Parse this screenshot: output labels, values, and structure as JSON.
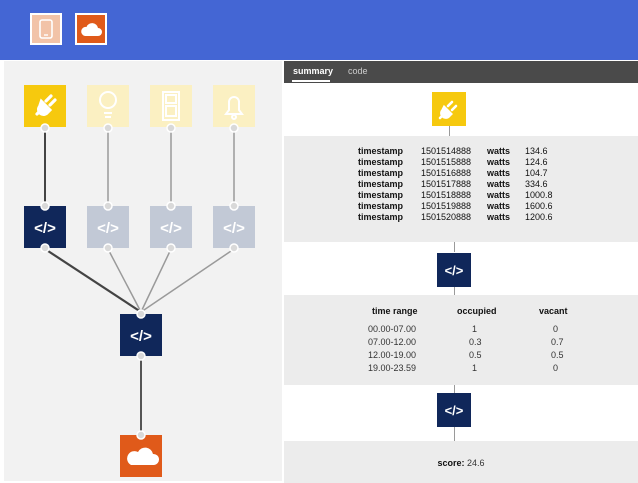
{
  "toolbar": {
    "buttons": [
      {
        "icon": "phone-icon",
        "color": "#f2c3a8"
      },
      {
        "icon": "cloud-icon",
        "color": "#e05a1a"
      }
    ]
  },
  "graph": {
    "sensors": [
      {
        "icon": "plug-icon",
        "active": true
      },
      {
        "icon": "lightbulb-icon",
        "active": false
      },
      {
        "icon": "door-icon",
        "active": false
      },
      {
        "icon": "bell-icon",
        "active": false
      }
    ],
    "code_nodes": [
      {
        "icon": "code-icon",
        "active": true
      },
      {
        "icon": "code-icon",
        "active": false
      },
      {
        "icon": "code-icon",
        "active": false
      },
      {
        "icon": "code-icon",
        "active": false
      }
    ],
    "merge_node": {
      "icon": "code-icon"
    },
    "output_node": {
      "icon": "cloud-icon"
    },
    "colors": {
      "sensor_active": "#f6c90e",
      "sensor_inactive": "#fbf0c2",
      "code_active": "#10275a",
      "code_inactive": "#c2c9d6",
      "output": "#e05a1a"
    }
  },
  "panel": {
    "tabs": [
      {
        "label": "summary",
        "active": true
      },
      {
        "label": "code",
        "active": false
      }
    ],
    "readings": [
      {
        "k1": "timestamp",
        "v1": "1501514888",
        "k2": "watts",
        "v2": "134.6"
      },
      {
        "k1": "timestamp",
        "v1": "1501515888",
        "k2": "watts",
        "v2": "124.6"
      },
      {
        "k1": "timestamp",
        "v1": "1501516888",
        "k2": "watts",
        "v2": "104.7"
      },
      {
        "k1": "timestamp",
        "v1": "1501517888",
        "k2": "watts",
        "v2": "334.6"
      },
      {
        "k1": "timestamp",
        "v1": "1501518888",
        "k2": "watts",
        "v2": "1000.8"
      },
      {
        "k1": "timestamp",
        "v1": "1501519888",
        "k2": "watts",
        "v2": "1600.6"
      },
      {
        "k1": "timestamp",
        "v1": "1501520888",
        "k2": "watts",
        "v2": "1200.6"
      }
    ],
    "occupancy": {
      "headers": [
        "time range",
        "occupied",
        "vacant"
      ],
      "rows": [
        [
          "00.00-07.00",
          "1",
          "0"
        ],
        [
          "07.00-12.00",
          "0.3",
          "0.7"
        ],
        [
          "12.00-19.00",
          "0.5",
          "0.5"
        ],
        [
          "19.00-23.59",
          "1",
          "0"
        ]
      ]
    },
    "score": {
      "label": "score:",
      "value": "24.6"
    }
  }
}
